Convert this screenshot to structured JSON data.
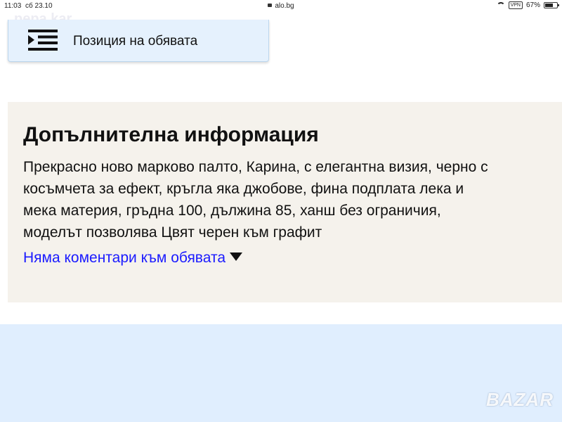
{
  "status": {
    "time": "11:03",
    "date": "сб 23.10",
    "url": "alo.bg",
    "vpn": "VPN",
    "battery": "67%",
    "battery_level": 0.67
  },
  "watermark_top": "pepa.kar",
  "position_card": {
    "icon": "list-indent-icon",
    "label": "Позиция на обявата"
  },
  "info": {
    "title": "Допълнителна информация",
    "lines": [
      "Прекрасно ново марково палто, Карина, с елегантна визия, черно с",
      "косъмчета за ефект, кръгла яка джобове, фина подплата лека и",
      "мека материя, гръдна 100, дължина 85, ханш без ограничия,",
      "моделът позволява Цвят черен към графит"
    ],
    "comments_link": "Няма коментари към обявата",
    "comments_icon": "triangle-down-icon"
  },
  "logo": "BAZAR",
  "colors": {
    "card_bg": "#e5f1fd",
    "info_bg": "#f5f2ec",
    "link": "#1a1aff",
    "bottom_bg": "#e0eefe"
  }
}
